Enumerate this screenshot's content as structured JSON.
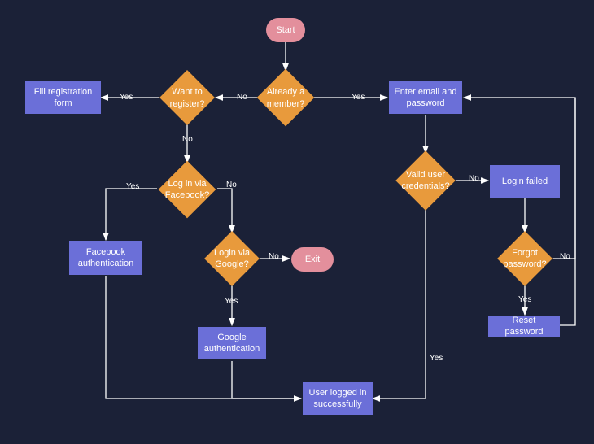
{
  "nodes": {
    "start": "Start",
    "already_member": "Already a member?",
    "want_register": "Want to register?",
    "fill_registration": "Fill registration form",
    "enter_email": "Enter email and password",
    "valid_credentials": "Valid user credentials?",
    "login_failed": "Login failed",
    "forgot_password": "Forgot password?",
    "reset_password": "Reset password",
    "login_facebook": "Log in via Facebook?",
    "login_google": "Login via Google?",
    "facebook_auth": "Facebook authentication",
    "google_auth": "Google authentication",
    "exit": "Exit",
    "logged_in": "User logged in successfully"
  },
  "labels": {
    "yes": "Yes",
    "no": "No"
  },
  "colors": {
    "background": "#1b2137",
    "terminal": "#e38f9c",
    "decision": "#e89a3c",
    "process": "#6b6fd8",
    "line": "#ffffff"
  }
}
